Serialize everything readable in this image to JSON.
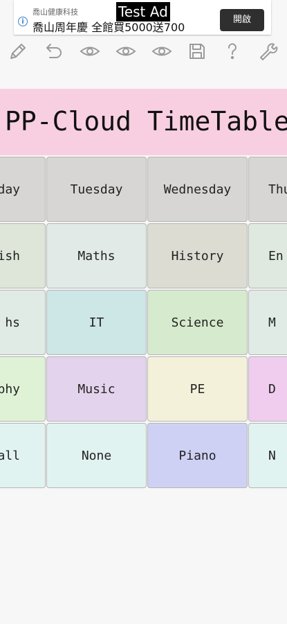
{
  "ad": {
    "tag": "Test Ad",
    "advertiser": "喬山健康科技",
    "headline": "喬山周年慶 全館買5000送700",
    "cta": "開啟",
    "info_icon": "info-icon"
  },
  "toolbar": {
    "icons": [
      "pencil-icon",
      "undo-icon",
      "eye-icon",
      "eye-icon",
      "eye-icon",
      "save-icon",
      "help-icon",
      "wrench-icon"
    ]
  },
  "title": "PP-Cloud TimeTable",
  "timetable": {
    "days": [
      "day",
      "Tuesday",
      "Wednesday",
      "Thu"
    ],
    "rows": [
      [
        "ish",
        "Maths",
        "History",
        "En"
      ],
      [
        "hs",
        "IT",
        "Science",
        "M"
      ],
      [
        "aphy",
        "Music",
        "PE",
        "D"
      ],
      [
        "ball",
        "None",
        "Piano",
        "N"
      ]
    ],
    "colors": {
      "header": "#d8d6d4",
      "rows": [
        [
          "#dde6d8",
          "#e1eae6",
          "#dcdcd2",
          "#e0e9e0"
        ],
        [
          "#e1ebe6",
          "#cde6e6",
          "#d6ebcd",
          "#e1ebe6"
        ],
        [
          "#dff2d6",
          "#e4d3ec",
          "#f4f1da",
          "#f0cdef"
        ],
        [
          "#e1f3f0",
          "#e1f3f0",
          "#cfd1f4",
          "#e1f3f0"
        ]
      ]
    }
  }
}
